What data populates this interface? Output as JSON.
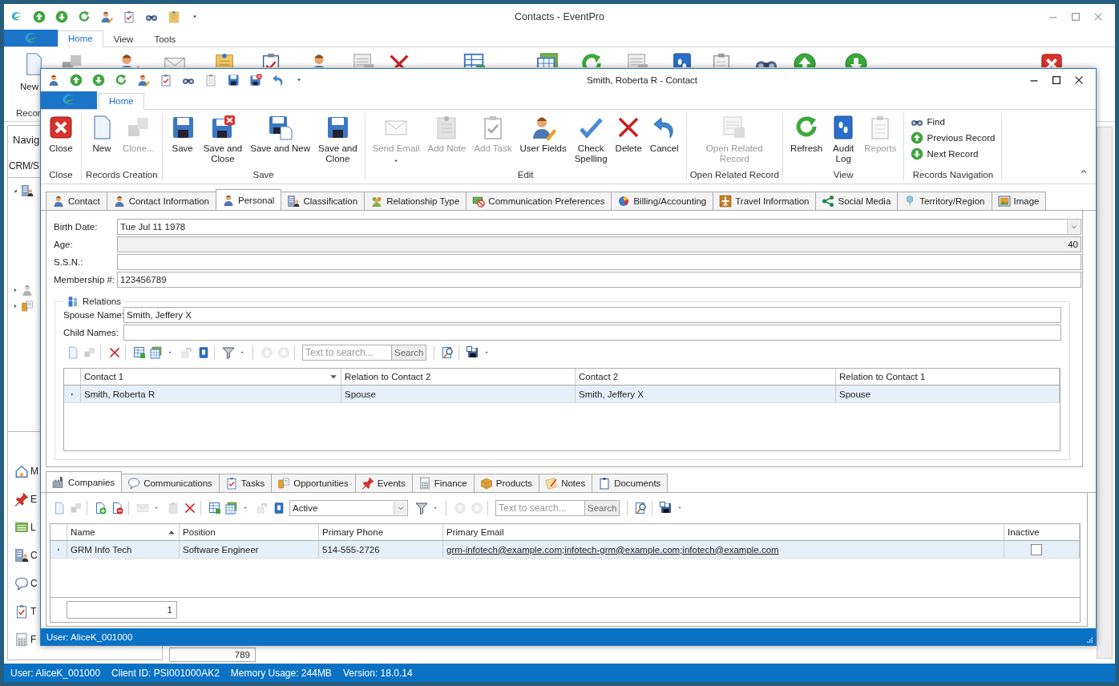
{
  "main_window": {
    "title": "Contacts - EventPro",
    "ribbon_tabs": [
      {
        "label": "Home",
        "selected": true
      },
      {
        "label": "View",
        "selected": false
      },
      {
        "label": "Tools",
        "selected": false
      }
    ],
    "ribbon_button": "New",
    "ribbon_group": "Recor",
    "navigation": {
      "title": "Navig",
      "subtitle": "CRM/S",
      "items": [
        {
          "kind": "home",
          "label": "M"
        },
        {
          "kind": "pushpin",
          "label": "E"
        },
        {
          "kind": "list",
          "label": "L"
        },
        {
          "kind": "building",
          "label": "C"
        },
        {
          "kind": "chat",
          "label": "C"
        },
        {
          "kind": "task",
          "label": "T"
        },
        {
          "kind": "calc",
          "label": "F"
        }
      ]
    },
    "count_field": "789",
    "status_bar": [
      "User: AliceK_001000",
      "Client ID: PSI001000AK2",
      "Memory Usage: 244MB",
      "Version: 18.0.14"
    ]
  },
  "contact_window": {
    "title": "Smith, Roberta R - Contact",
    "ribbon_tabs": [
      {
        "label": "Home",
        "selected": true
      }
    ],
    "ribbon_groups": [
      {
        "label": "Close",
        "kind": "large",
        "buttons": [
          {
            "label": "Close",
            "kind": "close",
            "disabled": false,
            "dropdown": false
          }
        ]
      },
      {
        "label": "Records Creation",
        "kind": "large",
        "buttons": [
          {
            "label": "New",
            "kind": "doc",
            "disabled": false,
            "dropdown": false
          },
          {
            "label": "Clone...",
            "kind": "clone",
            "disabled": true,
            "dropdown": false
          }
        ]
      },
      {
        "label": "Save",
        "kind": "large",
        "buttons": [
          {
            "label": "Save",
            "kind": "save",
            "disabled": false,
            "dropdown": false
          },
          {
            "label": "Save and\nClose",
            "kind": "saveclose",
            "disabled": false,
            "dropdown": false
          },
          {
            "label": "Save and New",
            "kind": "savenew",
            "disabled": false,
            "dropdown": false
          },
          {
            "label": "Save and\nClone",
            "kind": "save",
            "disabled": false,
            "dropdown": false
          }
        ]
      },
      {
        "label": "Edit",
        "kind": "large",
        "buttons": [
          {
            "label": "Send Email",
            "kind": "email",
            "disabled": true,
            "dropdown": true
          },
          {
            "label": "Add Note",
            "kind": "note",
            "disabled": true,
            "dropdown": false
          },
          {
            "label": "Add Task",
            "kind": "task",
            "disabled": true,
            "dropdown": false
          },
          {
            "label": "User Fields",
            "kind": "useredit",
            "disabled": false,
            "dropdown": false
          },
          {
            "label": "Check\nSpelling",
            "kind": "check",
            "disabled": false,
            "dropdown": false
          },
          {
            "label": "Delete",
            "kind": "xmark",
            "disabled": false,
            "dropdown": false
          },
          {
            "label": "Cancel",
            "kind": "undo",
            "disabled": false,
            "dropdown": false
          }
        ]
      },
      {
        "label": "Open Related Record",
        "kind": "large",
        "buttons": [
          {
            "label": "Open Related\nRecord",
            "kind": "related",
            "disabled": true,
            "dropdown": false
          }
        ]
      },
      {
        "label": "View",
        "kind": "large",
        "buttons": [
          {
            "label": "Refresh",
            "kind": "refresh",
            "disabled": false,
            "dropdown": false
          },
          {
            "label": "Audit\nLog",
            "kind": "audit",
            "disabled": false,
            "dropdown": false
          },
          {
            "label": "Reports",
            "kind": "clipboard",
            "disabled": true,
            "dropdown": false
          }
        ]
      },
      {
        "label": "Records Navigation",
        "kind": "small",
        "buttons": [
          {
            "label": "Find",
            "kind": "binoc",
            "disabled": false
          },
          {
            "label": "Previous Record",
            "kind": "up",
            "disabled": false
          },
          {
            "label": "Next Record",
            "kind": "down",
            "disabled": false
          }
        ]
      }
    ],
    "tabs": [
      {
        "label": "Contact",
        "kind": "person",
        "selected": false
      },
      {
        "label": "Contact Information",
        "kind": "person",
        "selected": false
      },
      {
        "label": "Personal",
        "kind": "person",
        "selected": true
      },
      {
        "label": "Classification",
        "kind": "building",
        "selected": false
      },
      {
        "label": "Relationship Type",
        "kind": "group",
        "selected": false
      },
      {
        "label": "Communication Preferences",
        "kind": "nomail",
        "selected": false
      },
      {
        "label": "Billing/Accounting",
        "kind": "pie",
        "selected": false
      },
      {
        "label": "Travel Information",
        "kind": "plane",
        "selected": false
      },
      {
        "label": "Social Media",
        "kind": "share",
        "selected": false
      },
      {
        "label": "Territory/Region",
        "kind": "pin",
        "selected": false
      },
      {
        "label": "Image",
        "kind": "image",
        "selected": false
      }
    ],
    "fields": [
      {
        "label": "Birth Date:",
        "kind": "date",
        "value": "Tue Jul 11 1978"
      },
      {
        "label": "Age:",
        "kind": "readonly",
        "value": "40"
      },
      {
        "label": "S.S.N.:",
        "kind": "text"
      },
      {
        "label": "Membership #:",
        "kind": "text",
        "value": "123456789"
      }
    ],
    "relations": {
      "title": "Relations",
      "fields": [
        {
          "label": "Spouse Name:",
          "value": "Smith, Jeffery X"
        },
        {
          "label": "Child Names:"
        }
      ],
      "search": {
        "placeholder": "Text to search...",
        "button": "Search"
      },
      "table": {
        "sort_descending": true,
        "columns": [
          {
            "label": "Contact 1",
            "sorted": true
          },
          {
            "label": "Relation to Contact 2",
            "sorted": false
          },
          {
            "label": "Contact 2",
            "sorted": false
          },
          {
            "label": "Relation to Contact 1",
            "sorted": false
          }
        ],
        "rows": [
          {
            "selected": true,
            "cells": [
              "Smith, Roberta R",
              "Spouse",
              "Smith, Jeffery X",
              "Spouse"
            ]
          }
        ]
      }
    },
    "bottom_tabs": [
      {
        "label": "Companies",
        "kind": "factory",
        "selected": true
      },
      {
        "label": "Communications",
        "kind": "chat",
        "selected": false
      },
      {
        "label": "Tasks",
        "kind": "task",
        "selected": false
      },
      {
        "label": "Opportunities",
        "kind": "coins",
        "selected": false
      },
      {
        "label": "Events",
        "kind": "pushpin",
        "selected": false
      },
      {
        "label": "Finance",
        "kind": "calc",
        "selected": false
      },
      {
        "label": "Products",
        "kind": "box",
        "selected": false
      },
      {
        "label": "Notes",
        "kind": "notes",
        "selected": false
      },
      {
        "label": "Documents",
        "kind": "document",
        "selected": false
      }
    ],
    "companies": {
      "filter": "Active",
      "search": {
        "placeholder": "Text to search...",
        "button": "Search"
      },
      "table": {
        "sort_descending": false,
        "columns": [
          {
            "label": "Name",
            "sorted": true
          },
          {
            "label": "Position",
            "sorted": false
          },
          {
            "label": "Primary Phone",
            "sorted": false
          },
          {
            "label": "Primary Email",
            "sorted": false
          },
          {
            "label": "Inactive",
            "sorted": false
          }
        ],
        "rows": [
          {
            "selected": true,
            "name": "GRM Info Tech",
            "position": "Software Engineer",
            "phone": "514-555-2726",
            "email": "grm-infotech@example.com;infotech-grm@example.com;infotech@example.com",
            "inactive": false
          }
        ]
      },
      "count": "1"
    },
    "status_bar": "User: AliceK_001000"
  }
}
